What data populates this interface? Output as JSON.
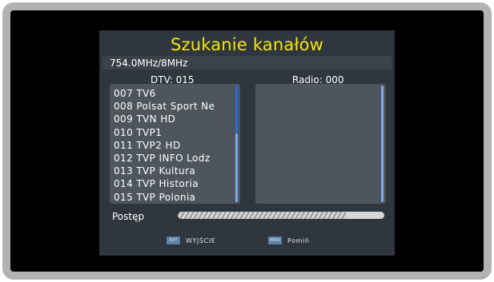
{
  "screen": {
    "title": "Szukanie kanałów",
    "frequency": "754.0MHz/8MHz",
    "dtv_header": "DTV: 015",
    "radio_header": "Radio: 000",
    "tv_channels": [
      "007 TV6",
      "008 Polsat Sport Ne",
      "009 TVN HD",
      "010 TVP1",
      "011 TVP2 HD",
      "012 TVP INFO Lodz",
      "013 TVP Kultura",
      "014 TVP Historia",
      "015 TVP Polonia"
    ],
    "radio_channels": [],
    "progress_label": "Postęp",
    "progress_fraction": 0.82
  },
  "footer": {
    "exit_key": "EXIT",
    "exit_label": "WYJŚCIE",
    "menu_key": "MENU",
    "menu_label": "Pomiń"
  },
  "colors": {
    "title": "#f2e60f",
    "osd_background": "#2f363d",
    "panel_background": "#4e555c",
    "scrollbar": "#2a6dd8"
  }
}
